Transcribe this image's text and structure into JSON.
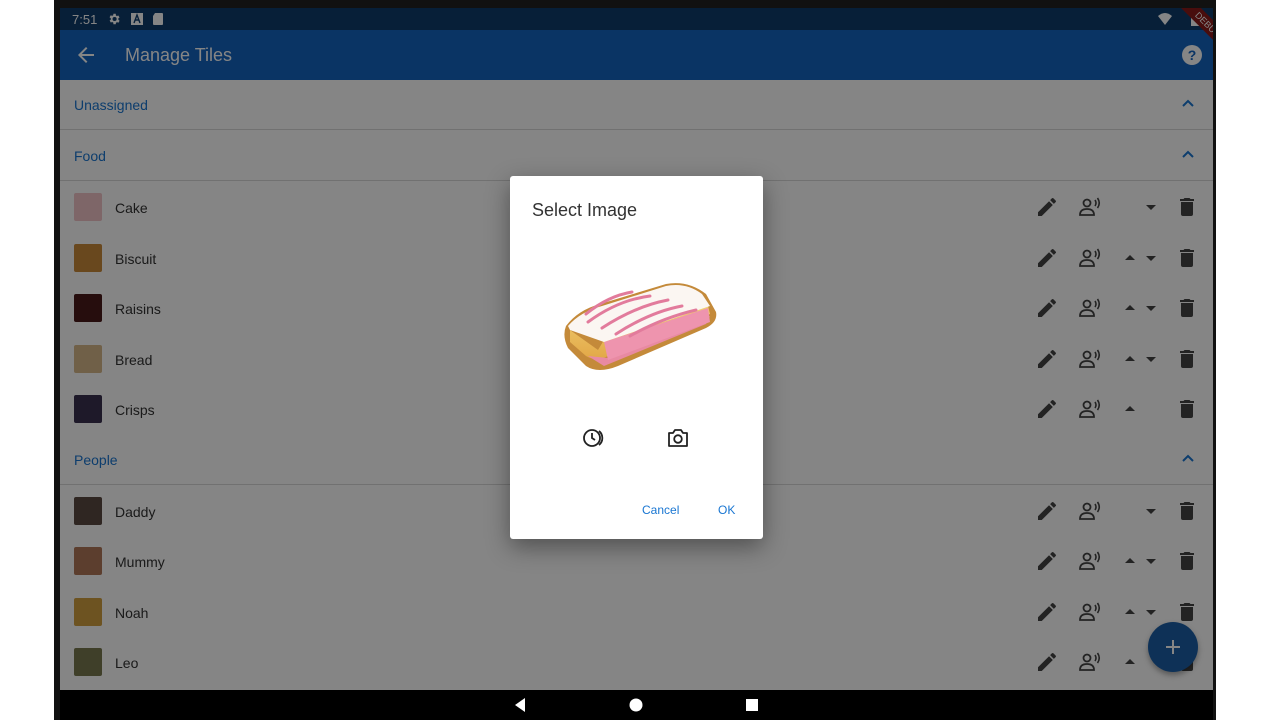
{
  "status_bar": {
    "time": "7:51",
    "icons": [
      "settings-icon",
      "a-notification-icon",
      "sd-card-icon",
      "wifi-icon",
      "battery-icon"
    ]
  },
  "app_bar": {
    "title": "Manage Tiles",
    "back_icon": "arrow-back-icon",
    "help_icon": "help-circle-icon",
    "debug_banner": "DEBUG"
  },
  "sections": [
    {
      "title": "Unassigned",
      "expanded": true,
      "items": []
    },
    {
      "title": "Food",
      "expanded": true,
      "items": [
        {
          "name": "Cake",
          "can_move_up": false,
          "can_move_down": true
        },
        {
          "name": "Biscuit",
          "can_move_up": true,
          "can_move_down": true
        },
        {
          "name": "Raisins",
          "can_move_up": true,
          "can_move_down": true
        },
        {
          "name": "Bread",
          "can_move_up": true,
          "can_move_down": true
        },
        {
          "name": "Crisps",
          "can_move_up": true,
          "can_move_down": false
        }
      ]
    },
    {
      "title": "People",
      "expanded": true,
      "items": [
        {
          "name": "Daddy",
          "can_move_up": false,
          "can_move_down": true
        },
        {
          "name": "Mummy",
          "can_move_up": true,
          "can_move_down": true
        },
        {
          "name": "Noah",
          "can_move_up": true,
          "can_move_down": true
        },
        {
          "name": "Leo",
          "can_move_up": true,
          "can_move_down": false
        }
      ]
    }
  ],
  "dialog": {
    "title": "Select Image",
    "image_subject": "cake-slice",
    "history_icon": "image-history-icon",
    "camera_icon": "camera-icon",
    "cancel_label": "Cancel",
    "ok_label": "OK"
  },
  "fab": {
    "icon": "add-icon"
  },
  "colors": {
    "primary": "#1565c0",
    "status_bar": "#0e3c6b",
    "accent_text": "#1976d2",
    "fab": "#1b5fa8"
  }
}
